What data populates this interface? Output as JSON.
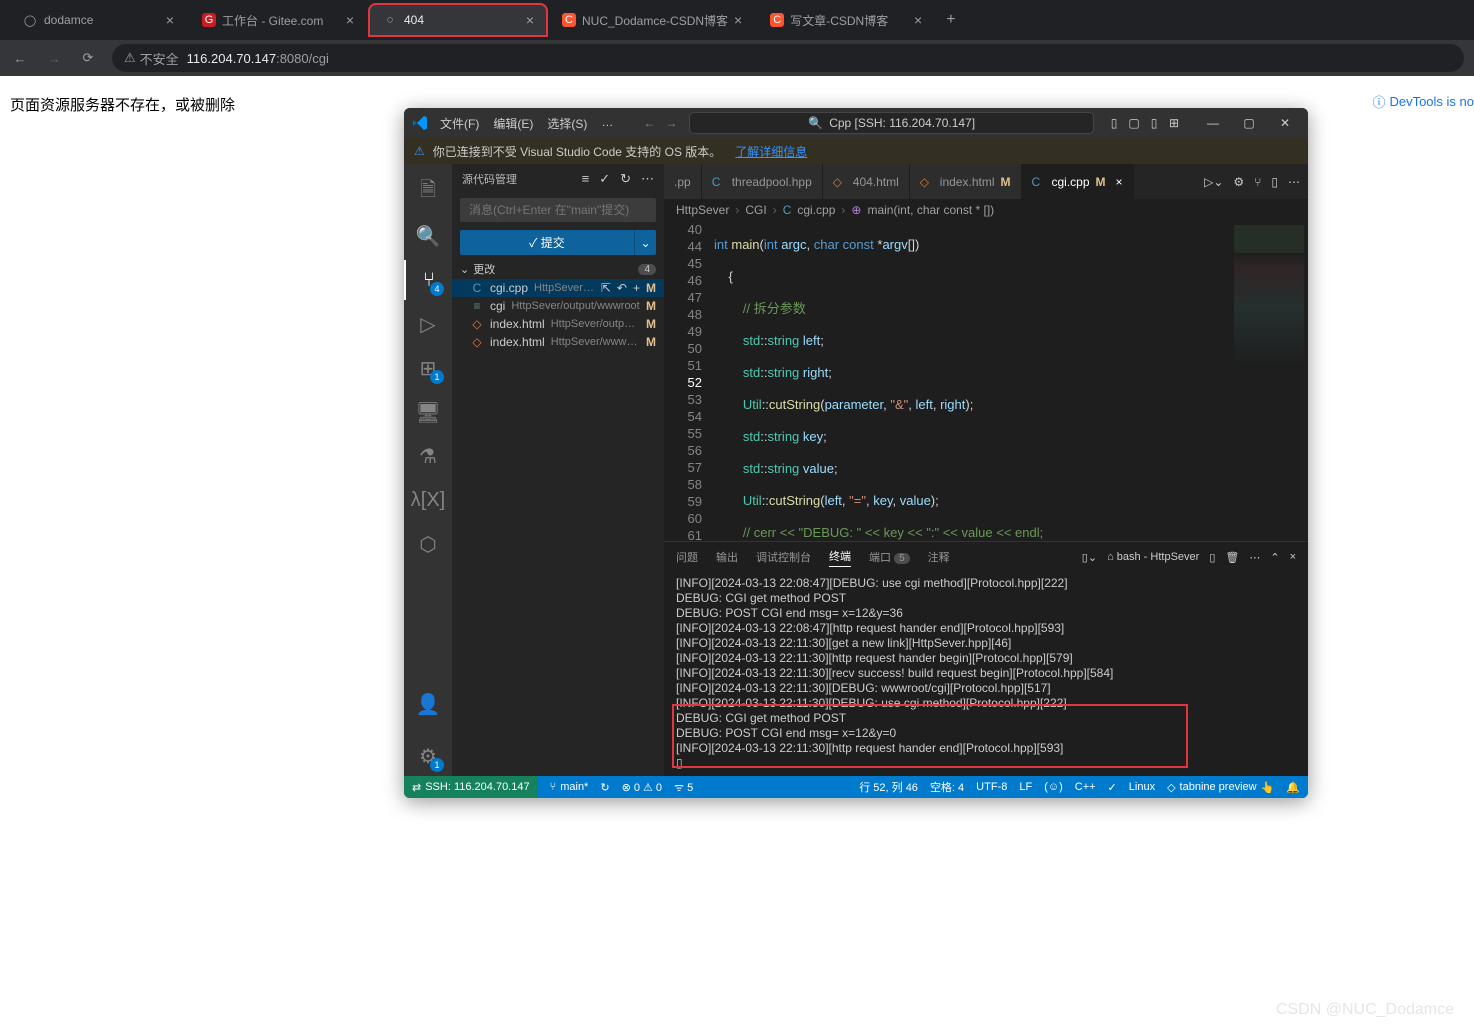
{
  "browser": {
    "tabs": [
      {
        "icon": "github",
        "title": "dodamce"
      },
      {
        "icon": "gitee",
        "title": "工作台 - Gitee.com"
      },
      {
        "icon": "spinner",
        "title": "404",
        "active": true,
        "highlight": true
      },
      {
        "icon": "csdn",
        "title": "NUC_Dodamce-CSDN博客"
      },
      {
        "icon": "csdn",
        "title": "写文章-CSDN博客"
      }
    ],
    "insecure": "不安全",
    "url_host": "116.204.70.147",
    "url_rest": ":8080/cgi",
    "page_text": "页面资源服务器不存在，或被删除",
    "devtools": "DevTools is no"
  },
  "vscode": {
    "menu": [
      "文件(F)",
      "编辑(E)",
      "选择(S)",
      "…"
    ],
    "search_text": "Cpp [SSH: 116.204.70.147]",
    "notice": "你已连接到不受 Visual Studio Code 支持的 OS 版本。",
    "notice_link": "了解详细信息",
    "scm": {
      "title": "源代码管理",
      "input_placeholder": "消息(Ctrl+Enter 在\"main\"提交)",
      "commit": "✓ 提交",
      "changes": "更改",
      "count": "4",
      "files": [
        {
          "icon": "C",
          "name": "cgi.cpp",
          "path": "HttpSever/CGI",
          "status": "M",
          "selected": true,
          "actions": true
        },
        {
          "icon": "≡",
          "name": "cgi",
          "path": "HttpSever/output/wwwroot",
          "status": "M"
        },
        {
          "icon": "<>",
          "name": "index.html",
          "path": "HttpSever/output/w...",
          "status": "M"
        },
        {
          "icon": "<>",
          "name": "index.html",
          "path": "HttpSever/wwwroot",
          "status": "M"
        }
      ]
    },
    "activity_badge_scm": "4",
    "activity_badge_ext": "1",
    "tabs": [
      {
        "icon": "C",
        "label": ".pp"
      },
      {
        "icon": "C",
        "label": "threadpool.hpp"
      },
      {
        "icon": "<>",
        "label": "404.html"
      },
      {
        "icon": "<>",
        "label": "index.html",
        "mod": "M"
      },
      {
        "icon": "C",
        "label": "cgi.cpp",
        "mod": "M",
        "active": true
      }
    ],
    "breadcrumb": [
      "HttpSever",
      "CGI",
      "cgi.cpp",
      "main(int, char const * [])"
    ],
    "code": {
      "lines": [
        40,
        44,
        45,
        46,
        47,
        48,
        49,
        50,
        51,
        52,
        53,
        54,
        55,
        56,
        57,
        58,
        59,
        60,
        61
      ]
    },
    "panel": {
      "tabs": [
        "问题",
        "输出",
        "调试控制台",
        "终端",
        "端口",
        "注释"
      ],
      "port_badge": "5",
      "shell": "bash - HttpSever",
      "terminal": [
        "[INFO][2024-03-13 22:08:47][DEBUG: use cgi method][Protocol.hpp][222]",
        "DEBUG: CGI get method POST",
        "DEBUG: POST CGI end msg= x=12&y=36",
        "[INFO][2024-03-13 22:08:47][http request hander end][Protocol.hpp][593]",
        "[INFO][2024-03-13 22:11:30][get a new link][HttpSever.hpp][46]",
        "[INFO][2024-03-13 22:11:30][http request hander begin][Protocol.hpp][579]",
        "[INFO][2024-03-13 22:11:30][recv success! build request begin][Protocol.hpp][584]",
        "[INFO][2024-03-13 22:11:30][DEBUG: wwwroot/cgi][Protocol.hpp][517]",
        "[INFO][2024-03-13 22:11:30][DEBUG: use cgi method][Protocol.hpp][222]",
        "DEBUG: CGI get method POST",
        "DEBUG: POST CGI end msg= x=12&y=0",
        "[INFO][2024-03-13 22:11:30][http request hander end][Protocol.hpp][593]",
        "▯"
      ]
    },
    "status": {
      "remote": "SSH: 116.204.70.147",
      "branch": "main*",
      "errors": "⊗ 0 ⚠ 0",
      "radio": "ᯤ 5",
      "position": "行 52, 列 46",
      "spaces": "空格: 4",
      "encoding": "UTF-8",
      "eol": "LF",
      "lang": "C++",
      "os": "Linux",
      "tabnine": "tabnine preview",
      "bell": "🔔"
    }
  },
  "watermark": "CSDN @NUC_Dodamce"
}
